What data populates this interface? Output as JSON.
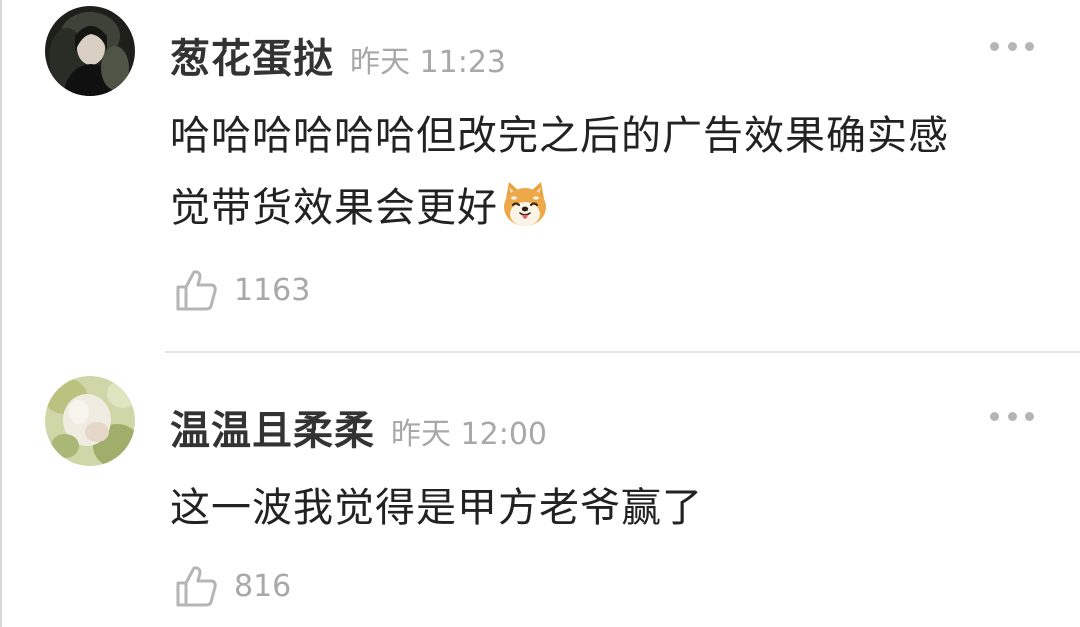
{
  "comments": [
    {
      "username": "葱花蛋挞",
      "time": "昨天 11:23",
      "content_lines": [
        "哈哈哈哈哈哈但改完之后的广告效果确实感",
        "觉带货效果会更好"
      ],
      "emoji": "shiba-dog-emoji",
      "likes": "1163",
      "avatar": "avatar-dark-portrait"
    },
    {
      "username": "温温且柔柔",
      "time": "昨天 12:00",
      "content_lines": [
        "这一波我觉得是甲方老爷赢了"
      ],
      "likes": "816",
      "avatar": "avatar-light-floral"
    }
  ],
  "icons": {
    "like": "thumbs-up-outline-icon",
    "more": "more-dots-icon"
  },
  "colors": {
    "username": "#333333",
    "meta": "#a8a8a8",
    "text": "#222222",
    "divider": "#e6e6e6",
    "icon": "#b5b5b5"
  }
}
